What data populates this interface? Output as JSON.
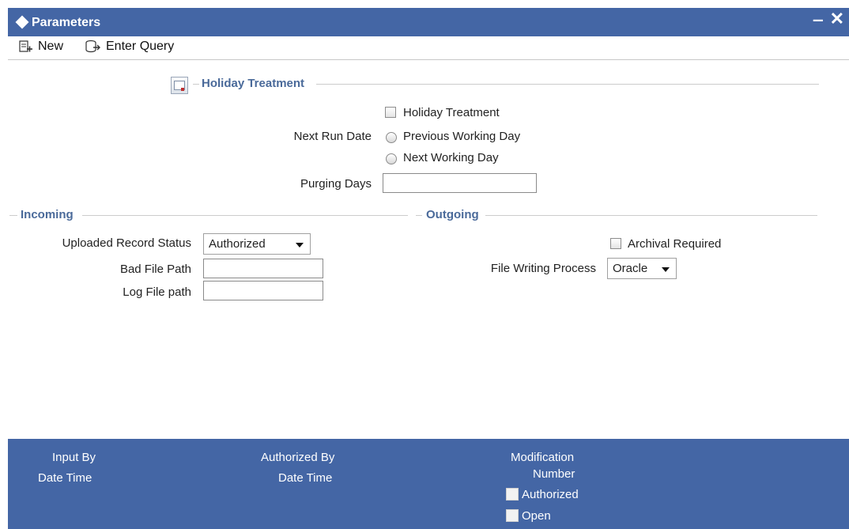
{
  "window": {
    "title": "Parameters",
    "minimize_glyph": "‒",
    "close_glyph": "✕"
  },
  "toolbar": {
    "new_label": "New",
    "enter_query_label": "Enter Query"
  },
  "holiday": {
    "section_title": "Holiday Treatment",
    "checkbox_label": "Holiday Treatment",
    "next_run_date_label": "Next Run Date",
    "option_previous": "Previous Working Day",
    "option_next": "Next Working Day",
    "purging_days_label": "Purging Days",
    "purging_days_value": ""
  },
  "incoming": {
    "section_title": "Incoming",
    "uploaded_status_label": "Uploaded Record Status",
    "uploaded_status_value": "Authorized",
    "bad_file_path_label": "Bad File Path",
    "bad_file_path_value": "",
    "log_file_path_label": "Log File path",
    "log_file_path_value": ""
  },
  "outgoing": {
    "section_title": "Outgoing",
    "archival_label": "Archival Required",
    "file_writing_label": "File Writing Process",
    "file_writing_value": "Oracle"
  },
  "footer": {
    "input_by": "Input By",
    "date_time_1": "Date Time",
    "authorized_by": "Authorized By",
    "date_time_2": "Date Time",
    "modification": "Modification",
    "number": "Number",
    "authorized": "Authorized",
    "open": "Open"
  },
  "colors": {
    "header": "#4466a5",
    "section_label": "#4a6a9a"
  }
}
